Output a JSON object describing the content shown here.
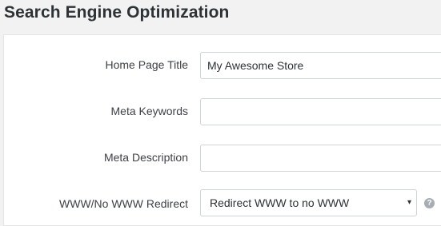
{
  "section": {
    "title": "Search Engine Optimization"
  },
  "form": {
    "home_page_title": {
      "label": "Home Page Title",
      "value": "My Awesome Store"
    },
    "meta_keywords": {
      "label": "Meta Keywords",
      "value": ""
    },
    "meta_description": {
      "label": "Meta Description",
      "value": ""
    },
    "www_redirect": {
      "label": "WWW/No WWW Redirect",
      "selected": "Redirect WWW to no WWW",
      "caret_icon": "▾",
      "help_icon": "?"
    }
  }
}
